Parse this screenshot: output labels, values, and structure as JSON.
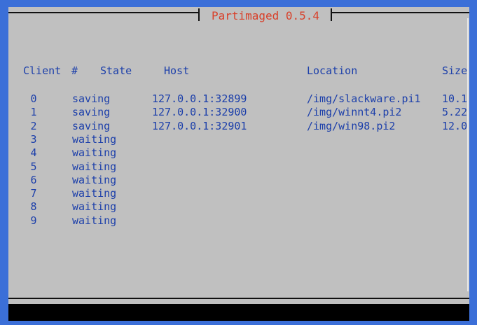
{
  "app": {
    "title": "Partimaged 0.5.4"
  },
  "columns": {
    "client": "Client",
    "num": "#",
    "state": "State",
    "host": "Host",
    "location": "Location",
    "size": "Size"
  },
  "rows": [
    {
      "num": "0",
      "state": "saving",
      "host": "127.0.0.1:32899",
      "location": "/img/slackware.pi1",
      "size": "10.1"
    },
    {
      "num": "1",
      "state": "saving",
      "host": "127.0.0.1:32900",
      "location": "/img/winnt4.pi2",
      "size": "5.22"
    },
    {
      "num": "2",
      "state": "saving",
      "host": "127.0.0.1:32901",
      "location": "/img/win98.pi2",
      "size": "12.0"
    },
    {
      "num": "3",
      "state": "waiting",
      "host": "",
      "location": "",
      "size": ""
    },
    {
      "num": "4",
      "state": "waiting",
      "host": "",
      "location": "",
      "size": ""
    },
    {
      "num": "5",
      "state": "waiting",
      "host": "",
      "location": "",
      "size": ""
    },
    {
      "num": "6",
      "state": "waiting",
      "host": "",
      "location": "",
      "size": ""
    },
    {
      "num": "7",
      "state": "waiting",
      "host": "",
      "location": "",
      "size": ""
    },
    {
      "num": "8",
      "state": "waiting",
      "host": "",
      "location": "",
      "size": ""
    },
    {
      "num": "9",
      "state": "waiting",
      "host": "",
      "location": "",
      "size": ""
    }
  ],
  "colors": {
    "background": "#c0c0c0",
    "text": "#1c3faa",
    "title": "#d8402a",
    "border": "#3b6fd8"
  }
}
